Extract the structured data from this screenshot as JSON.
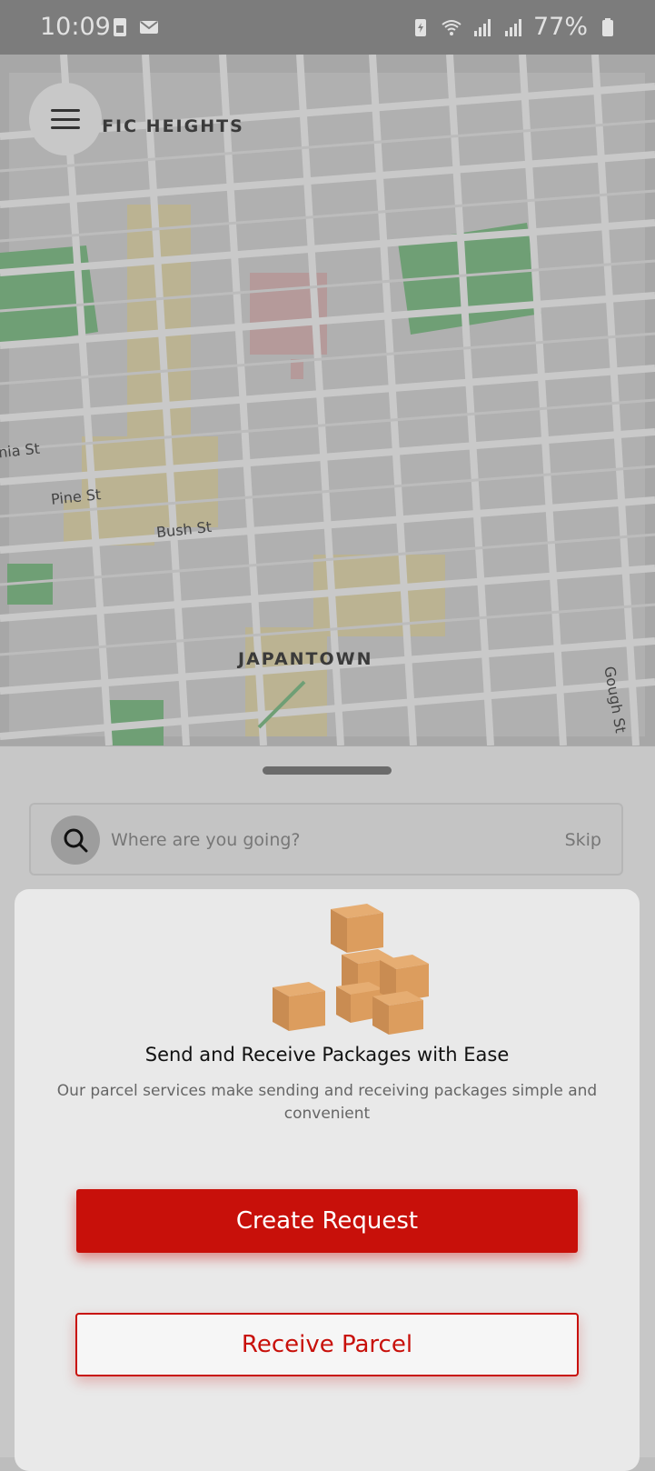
{
  "status_bar": {
    "time": "10:09",
    "battery": "77%",
    "icons": [
      "sim-icon",
      "mail-icon",
      "battery-saver-icon",
      "wifi-icon",
      "signal-icon",
      "signal-icon",
      "battery-icon"
    ]
  },
  "map": {
    "labels": {
      "district_top": "IFIC HEIGHTS",
      "district_bottom": "JAPANTOWN",
      "street_a": "nia St",
      "street_pine": "Pine St",
      "street_bush": "Bush St",
      "street_gough": "Gough St"
    }
  },
  "menu": {
    "icon": "hamburger-icon"
  },
  "search": {
    "placeholder": "Where are you going?",
    "skip_label": "Skip",
    "icon": "search-icon"
  },
  "card": {
    "illustration": "parcel-boxes-illustration",
    "title": "Send and Receive Packages with Ease",
    "subtitle": "Our parcel services  make sending and receiving packages simple and convenient",
    "primary_button": "Create Request",
    "secondary_button": "Receive Parcel"
  },
  "colors": {
    "accent": "#c8100a",
    "map_park": "#6f9f75",
    "map_commercial": "#bdb48f"
  }
}
